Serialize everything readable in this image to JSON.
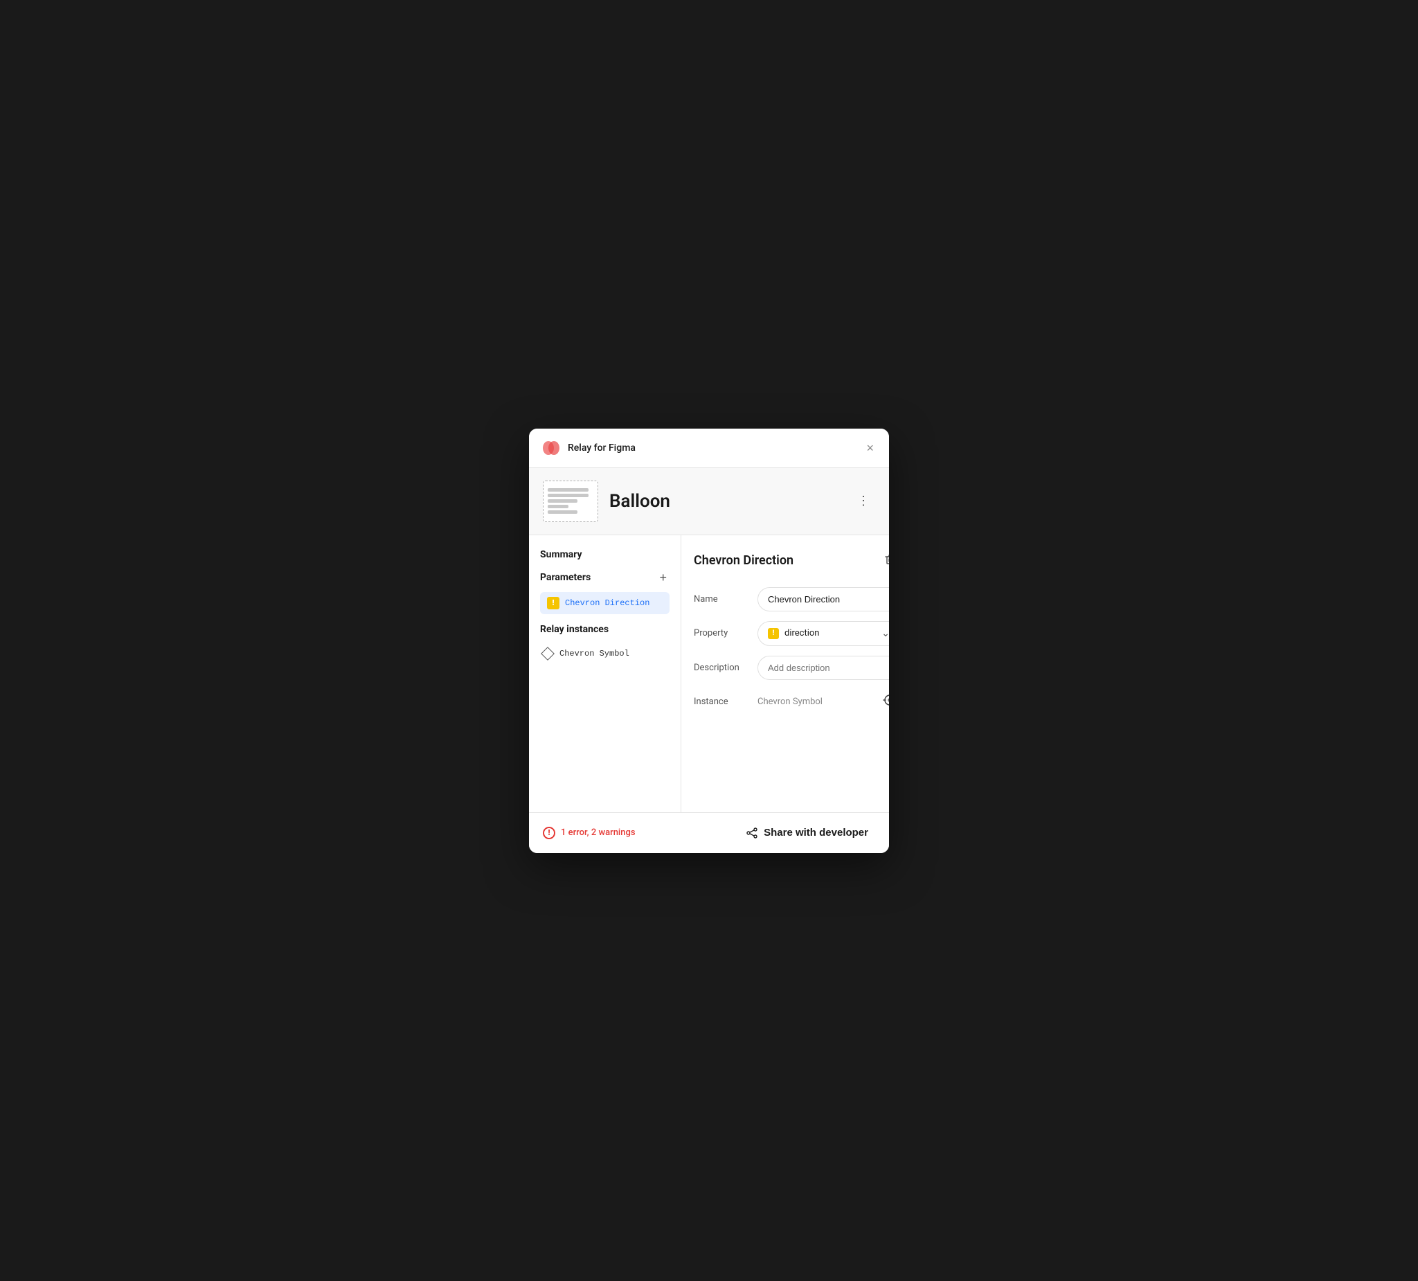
{
  "window": {
    "title": "Relay for Figma",
    "close_label": "×"
  },
  "component_header": {
    "name": "Balloon",
    "more_label": "⋮"
  },
  "left_panel": {
    "summary_label": "Summary",
    "parameters_label": "Parameters",
    "add_label": "+",
    "param_item": {
      "warning": "!",
      "name": "Chevron Direction"
    },
    "relay_instances_label": "Relay instances",
    "instance_item": {
      "name": "Chevron Symbol"
    }
  },
  "right_panel": {
    "title": "Chevron Direction",
    "delete_label": "🗑",
    "fields": {
      "name_label": "Name",
      "name_value": "Chevron Direction",
      "property_label": "Property",
      "property_warning": "!",
      "property_value": "direction",
      "description_label": "Description",
      "description_placeholder": "Add description",
      "instance_label": "Instance",
      "instance_value": "Chevron Symbol"
    }
  },
  "footer": {
    "error_icon": "!",
    "error_text": "1 error, 2 warnings",
    "share_label": "Share with developer"
  },
  "colors": {
    "accent_blue": "#1a6ef7",
    "warning_yellow": "#f5c400",
    "error_red": "#e53935",
    "param_bg": "#e8f0fe",
    "border": "#e5e5e5"
  }
}
